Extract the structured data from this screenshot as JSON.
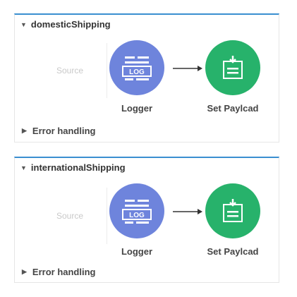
{
  "flows": [
    {
      "name": "domesticShipping",
      "source_placeholder": "Source",
      "processors": [
        {
          "label": "Logger",
          "icon": "logger-icon",
          "icon_text": "LOG",
          "color": "#6e84dc"
        },
        {
          "label": "Set Paylcad",
          "icon": "set-payload-icon",
          "color": "#27b26b"
        }
      ],
      "error_handling_label": "Error handling"
    },
    {
      "name": "internationalShipping",
      "source_placeholder": "Source",
      "processors": [
        {
          "label": "Logger",
          "icon": "logger-icon",
          "icon_text": "LOG",
          "color": "#6e84dc"
        },
        {
          "label": "Set Paylcad",
          "icon": "set-payload-icon",
          "color": "#27b26b"
        }
      ],
      "error_handling_label": "Error handling"
    }
  ],
  "colors": {
    "flow_border_top": "#3a8fd0",
    "logger": "#6e84dc",
    "set_payload": "#27b26b"
  }
}
